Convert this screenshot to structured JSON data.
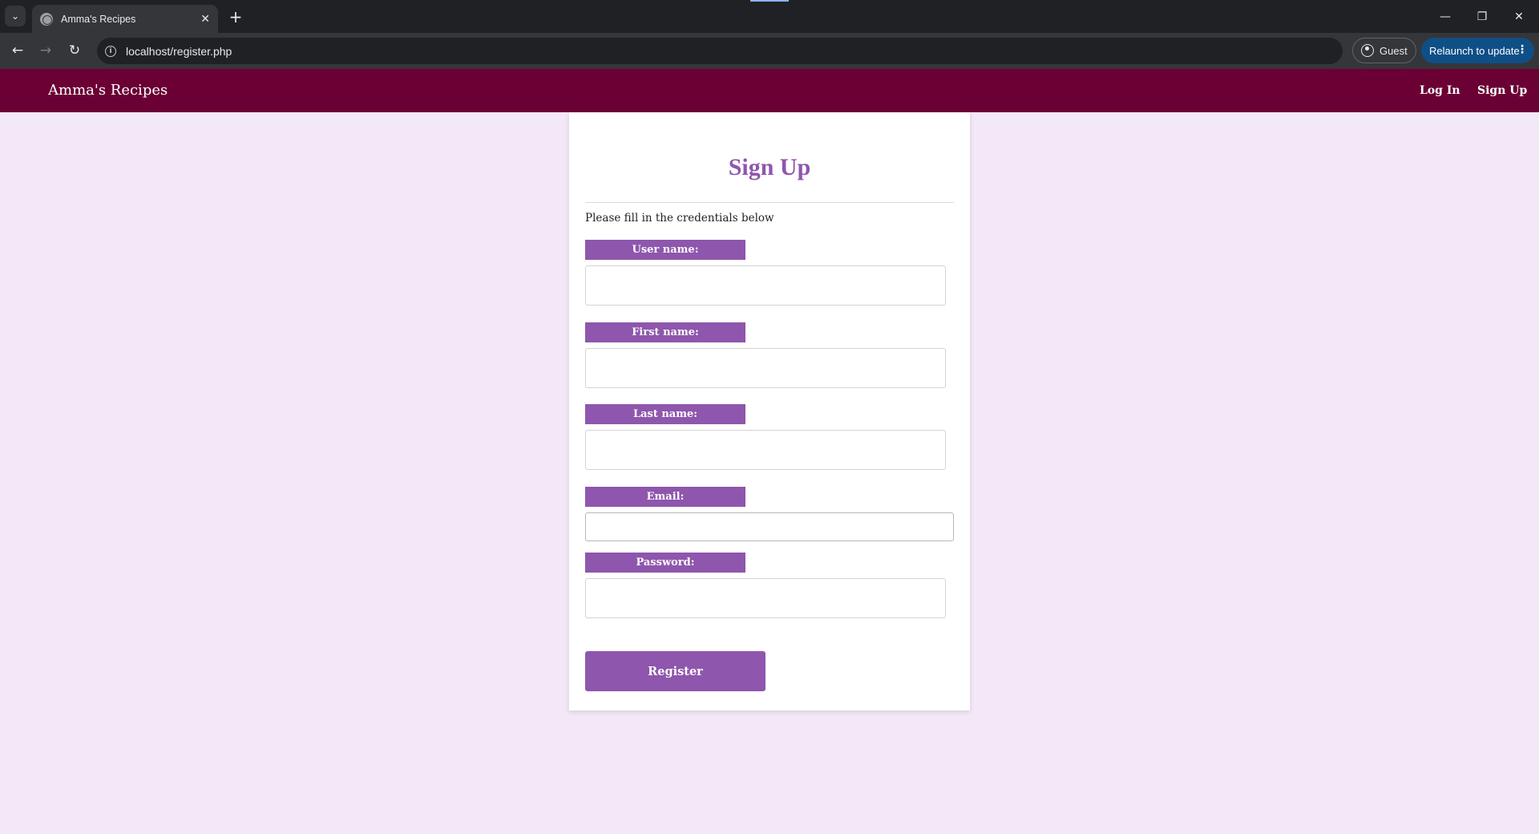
{
  "browser": {
    "tab_title": "Amma's Recipes",
    "url": "localhost/register.php",
    "profile_label": "Guest",
    "relaunch_label": "Relaunch to update"
  },
  "site": {
    "brand": "Amma's Recipes",
    "nav_login": "Log In",
    "nav_signup": "Sign Up",
    "nav_color": "#6b0034",
    "accent_color": "#8e56ad",
    "page_bg": "#f3e8f7"
  },
  "form": {
    "title": "Sign Up",
    "intro": "Please fill in the credentials below",
    "fields": [
      {
        "label": "User name:",
        "value": ""
      },
      {
        "label": "First name:",
        "value": ""
      },
      {
        "label": "Last name:",
        "value": ""
      },
      {
        "label": "Email:",
        "value": ""
      },
      {
        "label": "Password:",
        "value": ""
      }
    ],
    "submit_label": "Register"
  }
}
